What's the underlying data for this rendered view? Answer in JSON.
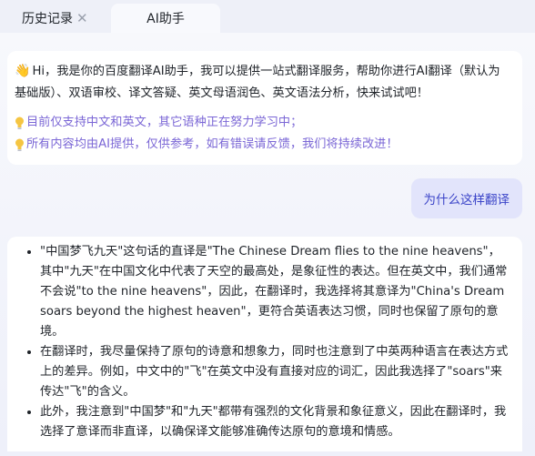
{
  "tabs": {
    "history_label": "历史记录",
    "ai_label": "AI助手"
  },
  "welcome": {
    "intro": "Hi，我是你的百度翻译AI助手，我可以提供一站式翻译服务，帮助你进行AI翻译（默认为基础版）、双语审校、译文答疑、英文母语润色、英文语法分析，快来试试吧！",
    "tip1": "目前仅支持中文和英文，其它语种正在努力学习中；",
    "tip2": "所有内容均由AI提供，仅供参考，如有错误请反馈，我们将持续改进！"
  },
  "user_message": "为什么这样翻译",
  "answer": {
    "points": [
      "\"中国梦飞九天\"这句话的直译是\"The Chinese Dream flies to the nine heavens\"，其中\"九天\"在中国文化中代表了天空的最高处，是象征性的表达。但在英文中，我们通常不会说\"to the nine heavens\"，因此，在翻译时，我选择将其意译为\"China's Dream soars beyond the highest heaven\"，更符合英语表达习惯，同时也保留了原句的意境。",
      "在翻译时，我尽量保持了原句的诗意和想象力，同时也注意到了中英两种语言在表达方式上的差异。例如，中文中的\"飞\"在英文中没有直接对应的词汇，因此我选择了\"soars\"来传达\"飞\"的含义。",
      "此外，我注意到\"中国梦\"和\"九天\"都带有强烈的文化背景和象征意义，因此在翻译时，我选择了意译而非直译，以确保译文能够准确传达原句的意境和情感。"
    ]
  },
  "colors": {
    "tip_text": "#7b67d6",
    "user_bubble_bg": "#e2e4fb",
    "user_bubble_text": "#3b44c8"
  },
  "icons": [
    "waving-hand-icon",
    "lightbulb-icon",
    "close-icon"
  ]
}
